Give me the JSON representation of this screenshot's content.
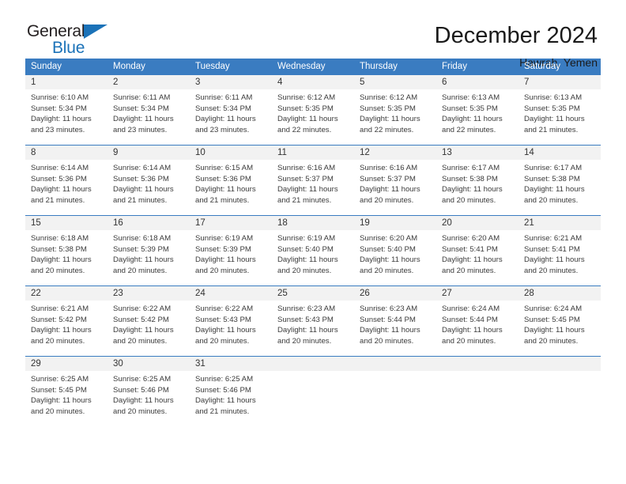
{
  "logo": {
    "word1": "General",
    "word2": "Blue",
    "triangle_color": "#1b72b8"
  },
  "header": {
    "title": "December 2024",
    "subtitle": "Hawrah, Yemen"
  },
  "theme": {
    "header_bg": "#3a7cc1",
    "daynum_bg": "#f2f2f2",
    "text": "#3b3b3b"
  },
  "weekdays": [
    "Sunday",
    "Monday",
    "Tuesday",
    "Wednesday",
    "Thursday",
    "Friday",
    "Saturday"
  ],
  "labels": {
    "sunrise_prefix": "Sunrise:",
    "sunset_prefix": "Sunset:",
    "daylight_prefix": "Daylight:"
  },
  "weeks": [
    [
      {
        "day": "1",
        "sunrise": "Sunrise: 6:10 AM",
        "sunset": "Sunset: 5:34 PM",
        "daylight1": "Daylight: 11 hours",
        "daylight2": "and 23 minutes."
      },
      {
        "day": "2",
        "sunrise": "Sunrise: 6:11 AM",
        "sunset": "Sunset: 5:34 PM",
        "daylight1": "Daylight: 11 hours",
        "daylight2": "and 23 minutes."
      },
      {
        "day": "3",
        "sunrise": "Sunrise: 6:11 AM",
        "sunset": "Sunset: 5:34 PM",
        "daylight1": "Daylight: 11 hours",
        "daylight2": "and 23 minutes."
      },
      {
        "day": "4",
        "sunrise": "Sunrise: 6:12 AM",
        "sunset": "Sunset: 5:35 PM",
        "daylight1": "Daylight: 11 hours",
        "daylight2": "and 22 minutes."
      },
      {
        "day": "5",
        "sunrise": "Sunrise: 6:12 AM",
        "sunset": "Sunset: 5:35 PM",
        "daylight1": "Daylight: 11 hours",
        "daylight2": "and 22 minutes."
      },
      {
        "day": "6",
        "sunrise": "Sunrise: 6:13 AM",
        "sunset": "Sunset: 5:35 PM",
        "daylight1": "Daylight: 11 hours",
        "daylight2": "and 22 minutes."
      },
      {
        "day": "7",
        "sunrise": "Sunrise: 6:13 AM",
        "sunset": "Sunset: 5:35 PM",
        "daylight1": "Daylight: 11 hours",
        "daylight2": "and 21 minutes."
      }
    ],
    [
      {
        "day": "8",
        "sunrise": "Sunrise: 6:14 AM",
        "sunset": "Sunset: 5:36 PM",
        "daylight1": "Daylight: 11 hours",
        "daylight2": "and 21 minutes."
      },
      {
        "day": "9",
        "sunrise": "Sunrise: 6:14 AM",
        "sunset": "Sunset: 5:36 PM",
        "daylight1": "Daylight: 11 hours",
        "daylight2": "and 21 minutes."
      },
      {
        "day": "10",
        "sunrise": "Sunrise: 6:15 AM",
        "sunset": "Sunset: 5:36 PM",
        "daylight1": "Daylight: 11 hours",
        "daylight2": "and 21 minutes."
      },
      {
        "day": "11",
        "sunrise": "Sunrise: 6:16 AM",
        "sunset": "Sunset: 5:37 PM",
        "daylight1": "Daylight: 11 hours",
        "daylight2": "and 21 minutes."
      },
      {
        "day": "12",
        "sunrise": "Sunrise: 6:16 AM",
        "sunset": "Sunset: 5:37 PM",
        "daylight1": "Daylight: 11 hours",
        "daylight2": "and 20 minutes."
      },
      {
        "day": "13",
        "sunrise": "Sunrise: 6:17 AM",
        "sunset": "Sunset: 5:38 PM",
        "daylight1": "Daylight: 11 hours",
        "daylight2": "and 20 minutes."
      },
      {
        "day": "14",
        "sunrise": "Sunrise: 6:17 AM",
        "sunset": "Sunset: 5:38 PM",
        "daylight1": "Daylight: 11 hours",
        "daylight2": "and 20 minutes."
      }
    ],
    [
      {
        "day": "15",
        "sunrise": "Sunrise: 6:18 AM",
        "sunset": "Sunset: 5:38 PM",
        "daylight1": "Daylight: 11 hours",
        "daylight2": "and 20 minutes."
      },
      {
        "day": "16",
        "sunrise": "Sunrise: 6:18 AM",
        "sunset": "Sunset: 5:39 PM",
        "daylight1": "Daylight: 11 hours",
        "daylight2": "and 20 minutes."
      },
      {
        "day": "17",
        "sunrise": "Sunrise: 6:19 AM",
        "sunset": "Sunset: 5:39 PM",
        "daylight1": "Daylight: 11 hours",
        "daylight2": "and 20 minutes."
      },
      {
        "day": "18",
        "sunrise": "Sunrise: 6:19 AM",
        "sunset": "Sunset: 5:40 PM",
        "daylight1": "Daylight: 11 hours",
        "daylight2": "and 20 minutes."
      },
      {
        "day": "19",
        "sunrise": "Sunrise: 6:20 AM",
        "sunset": "Sunset: 5:40 PM",
        "daylight1": "Daylight: 11 hours",
        "daylight2": "and 20 minutes."
      },
      {
        "day": "20",
        "sunrise": "Sunrise: 6:20 AM",
        "sunset": "Sunset: 5:41 PM",
        "daylight1": "Daylight: 11 hours",
        "daylight2": "and 20 minutes."
      },
      {
        "day": "21",
        "sunrise": "Sunrise: 6:21 AM",
        "sunset": "Sunset: 5:41 PM",
        "daylight1": "Daylight: 11 hours",
        "daylight2": "and 20 minutes."
      }
    ],
    [
      {
        "day": "22",
        "sunrise": "Sunrise: 6:21 AM",
        "sunset": "Sunset: 5:42 PM",
        "daylight1": "Daylight: 11 hours",
        "daylight2": "and 20 minutes."
      },
      {
        "day": "23",
        "sunrise": "Sunrise: 6:22 AM",
        "sunset": "Sunset: 5:42 PM",
        "daylight1": "Daylight: 11 hours",
        "daylight2": "and 20 minutes."
      },
      {
        "day": "24",
        "sunrise": "Sunrise: 6:22 AM",
        "sunset": "Sunset: 5:43 PM",
        "daylight1": "Daylight: 11 hours",
        "daylight2": "and 20 minutes."
      },
      {
        "day": "25",
        "sunrise": "Sunrise: 6:23 AM",
        "sunset": "Sunset: 5:43 PM",
        "daylight1": "Daylight: 11 hours",
        "daylight2": "and 20 minutes."
      },
      {
        "day": "26",
        "sunrise": "Sunrise: 6:23 AM",
        "sunset": "Sunset: 5:44 PM",
        "daylight1": "Daylight: 11 hours",
        "daylight2": "and 20 minutes."
      },
      {
        "day": "27",
        "sunrise": "Sunrise: 6:24 AM",
        "sunset": "Sunset: 5:44 PM",
        "daylight1": "Daylight: 11 hours",
        "daylight2": "and 20 minutes."
      },
      {
        "day": "28",
        "sunrise": "Sunrise: 6:24 AM",
        "sunset": "Sunset: 5:45 PM",
        "daylight1": "Daylight: 11 hours",
        "daylight2": "and 20 minutes."
      }
    ],
    [
      {
        "day": "29",
        "sunrise": "Sunrise: 6:25 AM",
        "sunset": "Sunset: 5:45 PM",
        "daylight1": "Daylight: 11 hours",
        "daylight2": "and 20 minutes."
      },
      {
        "day": "30",
        "sunrise": "Sunrise: 6:25 AM",
        "sunset": "Sunset: 5:46 PM",
        "daylight1": "Daylight: 11 hours",
        "daylight2": "and 20 minutes."
      },
      {
        "day": "31",
        "sunrise": "Sunrise: 6:25 AM",
        "sunset": "Sunset: 5:46 PM",
        "daylight1": "Daylight: 11 hours",
        "daylight2": "and 21 minutes."
      },
      {
        "day": "",
        "sunrise": "",
        "sunset": "",
        "daylight1": "",
        "daylight2": ""
      },
      {
        "day": "",
        "sunrise": "",
        "sunset": "",
        "daylight1": "",
        "daylight2": ""
      },
      {
        "day": "",
        "sunrise": "",
        "sunset": "",
        "daylight1": "",
        "daylight2": ""
      },
      {
        "day": "",
        "sunrise": "",
        "sunset": "",
        "daylight1": "",
        "daylight2": ""
      }
    ]
  ]
}
